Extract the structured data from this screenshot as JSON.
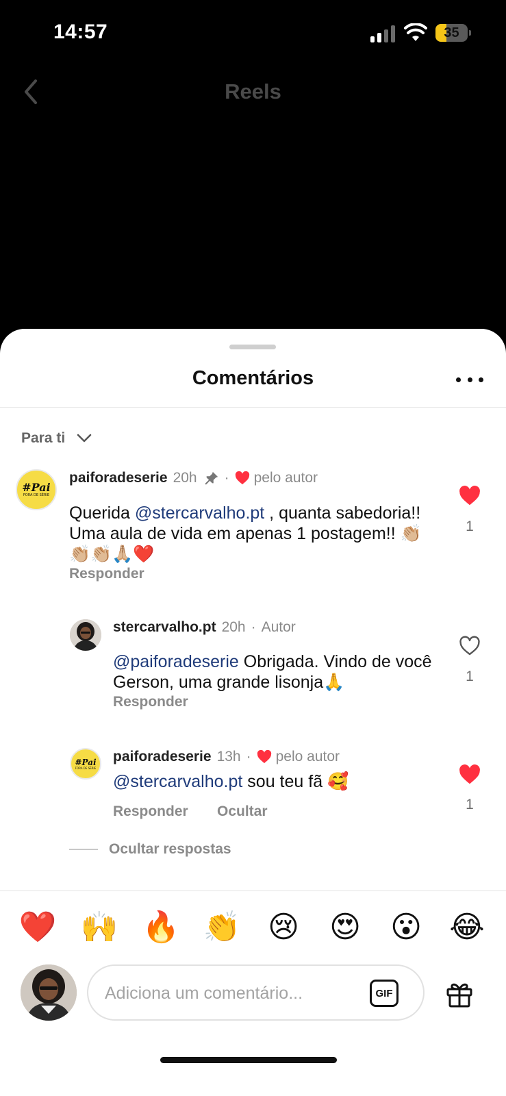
{
  "status_bar": {
    "time": "14:57",
    "battery": "35",
    "battery_level": 0.35
  },
  "nav": {
    "title": "Reels",
    "back_icon": "chevron-left-icon"
  },
  "sheet": {
    "title": "Comentários",
    "more_icon": "ellipsis-icon",
    "sort_label": "Para ti",
    "sort_icon": "chevron-down-icon"
  },
  "comments": [
    {
      "username": "paiforadeserie",
      "time": "20h",
      "pinned": true,
      "liked_by_author": "pelo autor",
      "mention": "@stercarvalho.pt",
      "text_before": "Querida ",
      "text_after": " , quanta sabedoria!! Uma aula de vida  em apenas 1 postagem!! 👏🏼👏🏼👏🏼🙏🏼❤️",
      "reply_label": "Responder",
      "likes": "1",
      "liked": true,
      "avatar_logo": {
        "main": "#Pai",
        "sub": "FORA DE SÉRIE"
      }
    },
    {
      "username": "stercarvalho.pt",
      "time": "20h",
      "badge": "Autor",
      "mention": "@paiforadeserie",
      "text_after": " Obrigada. Vindo de você Gerson, uma grande lisonja🙏",
      "reply_label": "Responder",
      "likes": "1",
      "liked": false
    },
    {
      "username": "paiforadeserie",
      "time": "13h",
      "liked_by_author": "pelo autor",
      "mention": "@stercarvalho.pt",
      "text_after": " sou teu fã 🥰",
      "reply_label": "Responder",
      "hide_label": "Ocultar",
      "likes": "1",
      "liked": true,
      "avatar_logo": {
        "main": "#Pai",
        "sub": "FORA DE SÉRIE"
      }
    }
  ],
  "hide_replies_label": "Ocultar respostas",
  "emoji_bar": [
    "❤️",
    "🙌",
    "🔥",
    "👏",
    "😢",
    "😍",
    "😮",
    "😂"
  ],
  "composer": {
    "placeholder": "Adiciona um comentário...",
    "gif_label": "GIF",
    "gift_icon": "gift-icon"
  },
  "colors": {
    "like_red": "#ff3040",
    "mention_blue": "#1f3b7a",
    "battery_yellow": "#f5c518"
  }
}
